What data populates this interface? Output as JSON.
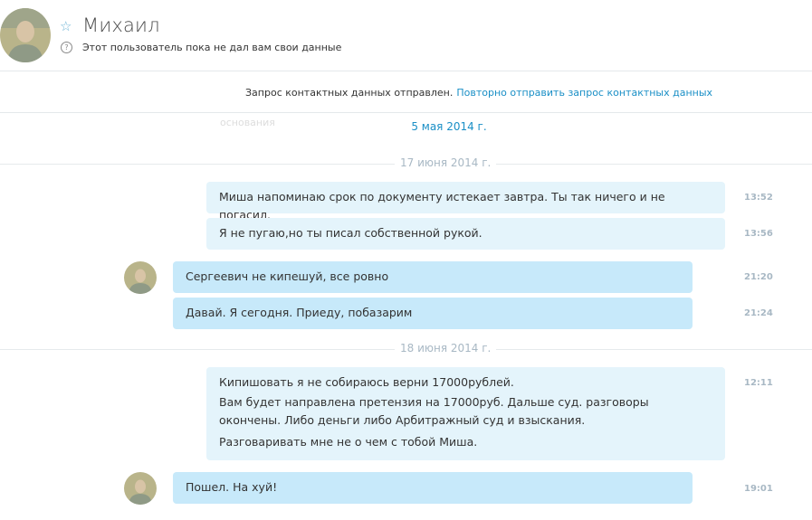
{
  "contact": {
    "name": "Михаил",
    "status": "Этот пользователь пока не дал вам свои данные"
  },
  "notice": {
    "text": "Запрос контактных данных отправлен.",
    "link": "Повторно отправить запрос контактных данных"
  },
  "faded_text": "основания",
  "date_link": "5 мая 2014 г.",
  "date_separators": [
    "17 июня 2014 г.",
    "18 июня 2014 г."
  ],
  "messages": [
    {
      "direction": "out",
      "lines": [
        "Миша напоминаю срок по документу истекает завтра. Ты так ничего и не погасил."
      ],
      "time": "13:52"
    },
    {
      "direction": "out",
      "lines": [
        "Я не пугаю,но ты писал собственной рукой."
      ],
      "time": "13:56"
    },
    {
      "direction": "in",
      "lines": [
        "Сергеевич не кипешуй, все ровно"
      ],
      "time": "21:20"
    },
    {
      "direction": "in",
      "lines": [
        "Давай. Я сегодня. Приеду, побазарим"
      ],
      "time": "21:24"
    },
    {
      "direction": "out",
      "lines": [
        "Кипишовать я не собираюсь верни 17000рублей.",
        "Вам будет направлена претензия на 17000руб. Дальше суд. разговоры окончены. Либо деньги либо Арбитражный суд и взыскания.",
        "Разговаривать мне не о чем с тобой Миша."
      ],
      "time": "12:11"
    },
    {
      "direction": "in",
      "lines": [
        "Пошел. На хуй!"
      ],
      "time": "19:01"
    }
  ],
  "colors": {
    "accent": "#1a8fc6",
    "bubble_out": "#e4f4fb",
    "bubble_in": "#c7e9fa",
    "muted": "#a8b8c4"
  }
}
